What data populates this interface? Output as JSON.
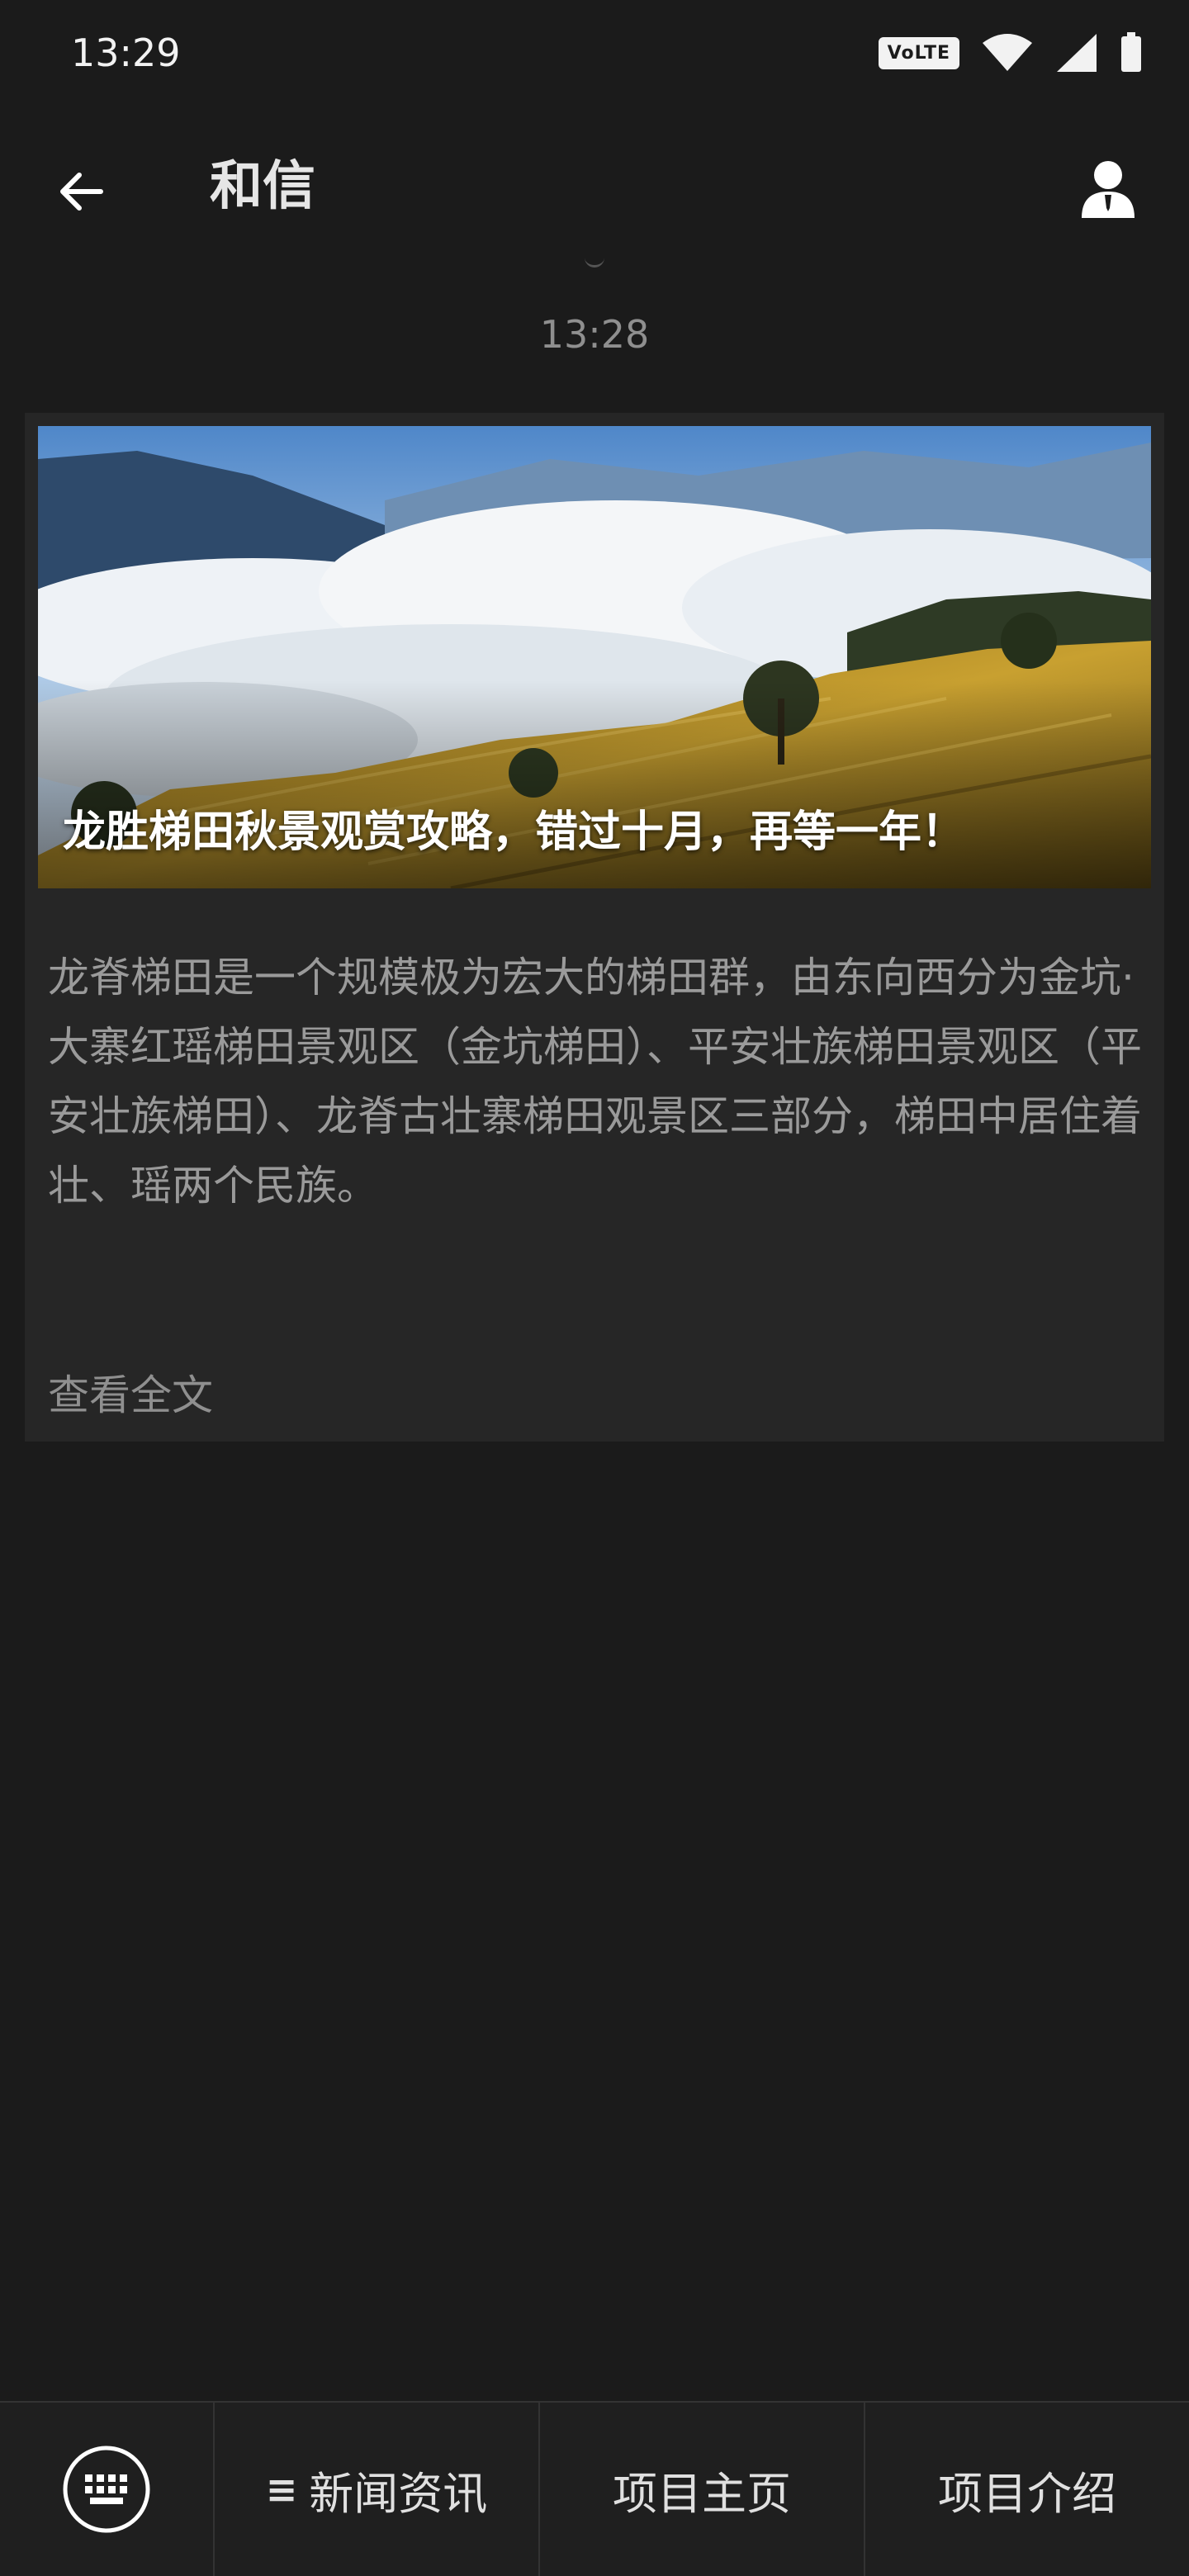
{
  "status_bar": {
    "time": "13:29",
    "volte": "VoLTE",
    "icons": [
      "volte-icon",
      "wifi-icon",
      "cell-signal-icon",
      "battery-icon"
    ]
  },
  "app_bar": {
    "title": "和信",
    "back_icon": "arrow-left-icon",
    "profile_icon": "user-icon"
  },
  "chat": {
    "timestamp": "13:28"
  },
  "card": {
    "image_caption": "龙胜梯田秋景观赏攻略，错过十月，再等一年！",
    "body": "龙脊梯田是一个规模极为宏大的梯田群，由东向西分为金坑·大寨红瑶梯田景观区（金坑梯田）、平安壮族梯田景观区（平安壮族梯田）、龙脊古壮寨梯田观景区三部分，梯田中居住着壮、瑶两个民族。",
    "read_more": "查看全文"
  },
  "bottom_bar": {
    "keyboard_icon": "keyboard-icon",
    "menus": [
      {
        "prefix": "≡",
        "label": "新闻资讯"
      },
      {
        "prefix": "",
        "label": "项目主页"
      },
      {
        "prefix": "",
        "label": "项目介绍"
      }
    ]
  },
  "colors": {
    "background": "#1b1b1b",
    "card": "#262626",
    "bottom_bar": "#1f1f1f",
    "text_primary": "#e6e6e6",
    "text_secondary": "#9a9a9a"
  }
}
